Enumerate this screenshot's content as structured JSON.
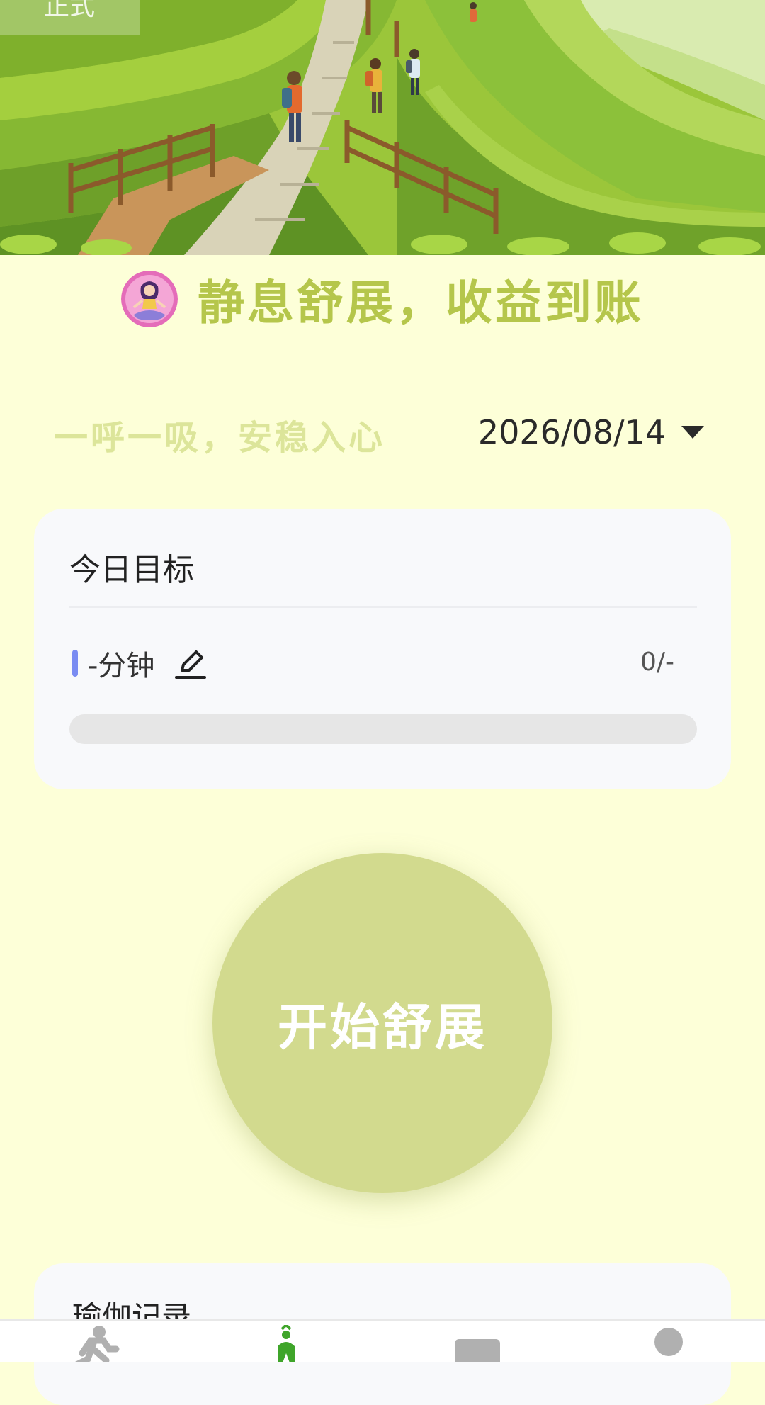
{
  "hero": {
    "env_badge": "正式",
    "image": "tea-terrace-hikers-illustration"
  },
  "header": {
    "avatar_icon": "yoga-avatar-icon",
    "title": "静息舒展，收益到账"
  },
  "slogan": "一呼一吸，安稳入心",
  "date_picker": {
    "value": "2026/08/14",
    "icon": "caret-down-icon"
  },
  "goal_card": {
    "title": "今日目标",
    "minutes_label": "-分钟",
    "edit_icon": "edit-pencil-icon",
    "count": "0/-",
    "progress": 0
  },
  "start_button": {
    "label": "开始舒展"
  },
  "records_card": {
    "title": "瑜伽记录"
  },
  "bottom_nav": {
    "items": [
      {
        "icon": "running-person-icon",
        "active": false
      },
      {
        "icon": "yoga-icon",
        "active": true
      },
      {
        "icon": "card-icon",
        "active": false
      },
      {
        "icon": "profile-icon",
        "active": false
      }
    ]
  },
  "colors": {
    "background": "#FDFFD8",
    "title": "#B5C64B",
    "slogan": "#DCE59A",
    "start_button": "#D2DA8E",
    "goal_accent": "#7A8CF2",
    "nav_active": "#3FA52A",
    "nav_inactive": "#B0B0B0"
  }
}
